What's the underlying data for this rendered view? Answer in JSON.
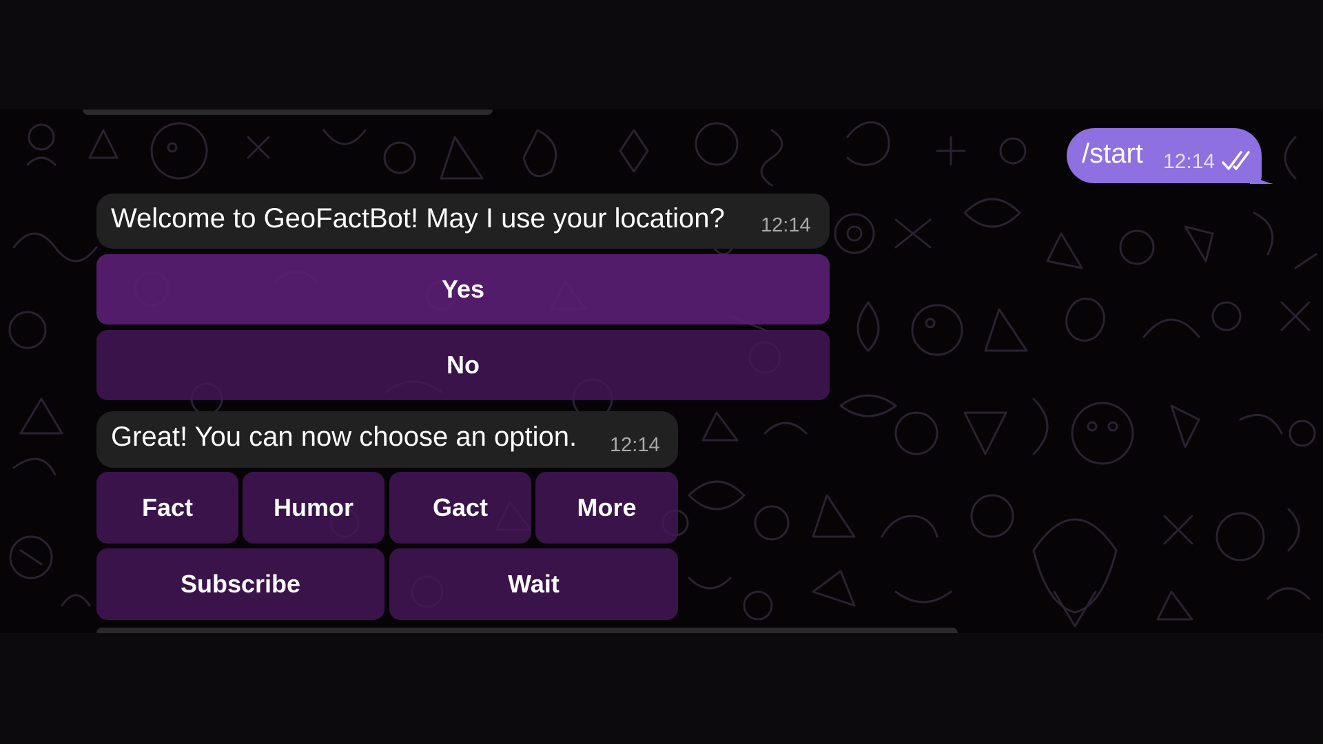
{
  "outgoing": {
    "text": "/start",
    "time": "12:14",
    "status_icon": "double-check-icon"
  },
  "messages": [
    {
      "text": "Welcome to GeoFactBot! May I use your location?",
      "time": "12:14",
      "buttons": [
        [
          "Yes"
        ],
        [
          "No"
        ]
      ]
    },
    {
      "text": "Great! You can now choose an option.",
      "time": "12:14",
      "buttons": [
        [
          "Fact",
          "Humor",
          "Gact",
          "More"
        ],
        [
          "Subscribe",
          "Wait"
        ]
      ]
    }
  ],
  "colors": {
    "outgoing_bubble": "#8e70e0",
    "incoming_bubble": "#212121",
    "button_bg": "#5a1e73",
    "wallpaper": "#060406",
    "doodle_stroke": "#2a2230"
  }
}
